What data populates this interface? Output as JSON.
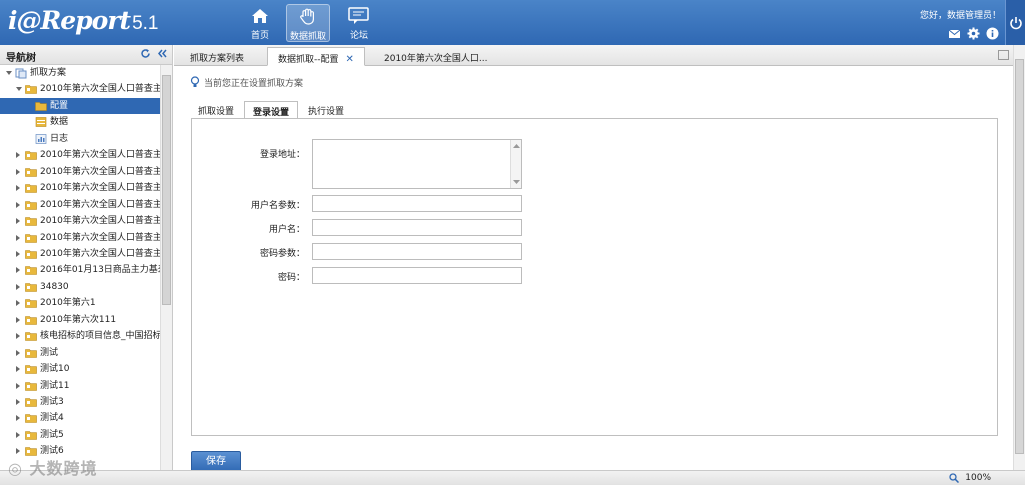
{
  "app": {
    "logo_text": "i@Report",
    "version": "5.1",
    "greeting": "您好，数据管理员！"
  },
  "nav": [
    {
      "label": "首页",
      "icon": "home-icon"
    },
    {
      "label": "数据抓取",
      "icon": "grab-hand-icon"
    },
    {
      "label": "论坛",
      "icon": "forum-icon"
    }
  ],
  "header_icons": [
    "mail-icon",
    "gear-icon",
    "info-icon",
    "power-icon"
  ],
  "sidebar": {
    "title": "导航树",
    "nodes": [
      {
        "label": "抓取方案",
        "level": 0,
        "state": "open",
        "icon": "scheme-icon"
      },
      {
        "label": "2010年第六次全国人口普查主",
        "level": 1,
        "state": "open",
        "icon": "folder-icon"
      },
      {
        "label": "配置",
        "level": 2,
        "state": "leaf",
        "icon": "config-icon",
        "selected": true
      },
      {
        "label": "数据",
        "level": 2,
        "state": "leaf",
        "icon": "data-icon"
      },
      {
        "label": "日志",
        "level": 2,
        "state": "leaf",
        "icon": "log-icon"
      },
      {
        "label": "2010年第六次全国人口普查主",
        "level": 1,
        "state": "closed",
        "icon": "folder-icon"
      },
      {
        "label": "2010年第六次全国人口普查主",
        "level": 1,
        "state": "closed",
        "icon": "folder-icon"
      },
      {
        "label": "2010年第六次全国人口普查主",
        "level": 1,
        "state": "closed",
        "icon": "folder-icon"
      },
      {
        "label": "2010年第六次全国人口普查主",
        "level": 1,
        "state": "closed",
        "icon": "folder-icon"
      },
      {
        "label": "2010年第六次全国人口普查主",
        "level": 1,
        "state": "closed",
        "icon": "folder-icon"
      },
      {
        "label": "2010年第六次全国人口普查主",
        "level": 1,
        "state": "closed",
        "icon": "folder-icon"
      },
      {
        "label": "2010年第六次全国人口普查主",
        "level": 1,
        "state": "closed",
        "icon": "folder-icon"
      },
      {
        "label": "2016年01月13日商品主力基差",
        "level": 1,
        "state": "closed",
        "icon": "folder-icon"
      },
      {
        "label": "34830",
        "level": 1,
        "state": "closed",
        "icon": "folder-icon"
      },
      {
        "label": "2010年第六1",
        "level": 1,
        "state": "closed",
        "icon": "folder-icon"
      },
      {
        "label": "2010年第六次111",
        "level": 1,
        "state": "closed",
        "icon": "folder-icon"
      },
      {
        "label": "核电招标的项目信息_中国招标",
        "level": 1,
        "state": "closed",
        "icon": "folder-icon"
      },
      {
        "label": "测试",
        "level": 1,
        "state": "closed",
        "icon": "folder-icon"
      },
      {
        "label": "测试10",
        "level": 1,
        "state": "closed",
        "icon": "folder-icon"
      },
      {
        "label": "测试11",
        "level": 1,
        "state": "closed",
        "icon": "folder-icon"
      },
      {
        "label": "测试3",
        "level": 1,
        "state": "closed",
        "icon": "folder-icon"
      },
      {
        "label": "测试4",
        "level": 1,
        "state": "closed",
        "icon": "folder-icon"
      },
      {
        "label": "测试5",
        "level": 1,
        "state": "closed",
        "icon": "folder-icon"
      },
      {
        "label": "测试6",
        "level": 1,
        "state": "closed",
        "icon": "folder-icon"
      }
    ]
  },
  "tabs": [
    {
      "label": "抓取方案列表",
      "active": false,
      "closable": false
    },
    {
      "label": "数据抓取--配置",
      "active": true,
      "closable": true
    },
    {
      "label": "2010年第六次全国人口...",
      "active": false,
      "closable": false
    }
  ],
  "hint": "当前您正在设置抓取方案",
  "subtabs": [
    {
      "label": "抓取设置",
      "active": false
    },
    {
      "label": "登录设置",
      "active": true
    },
    {
      "label": "执行设置",
      "active": false
    }
  ],
  "form": {
    "login_url_label": "登录地址：",
    "login_url_value": "",
    "username_param_label": "用户名参数：",
    "username_param_value": "",
    "username_label": "用户名：",
    "username_value": "",
    "password_param_label": "密码参数：",
    "password_param_value": "",
    "password_label": "密码：",
    "password_value": ""
  },
  "save_label": "保存",
  "status": {
    "zoom": "100%"
  },
  "watermark": "大数跨境",
  "colors": {
    "header": "#2f68b3",
    "selected": "#2f68b3",
    "folder": "#e8b83c"
  }
}
